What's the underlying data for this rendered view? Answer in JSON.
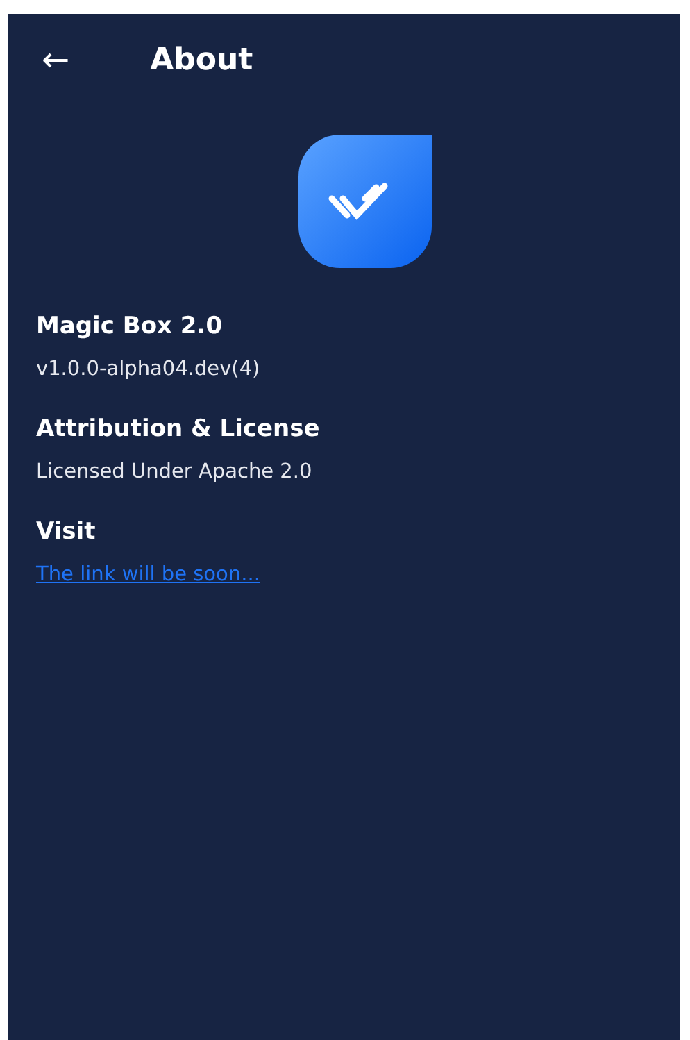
{
  "header": {
    "back": "←",
    "title": "About"
  },
  "sections": [
    {
      "title": "Magic Box 2.0",
      "kind": "text",
      "body": "v1.0.0-alpha04.dev(4)"
    },
    {
      "title": "Attribution & License",
      "kind": "text",
      "body": "Licensed Under Apache 2.0"
    },
    {
      "title": "Visit",
      "kind": "link",
      "body": "The link will be soon..."
    }
  ]
}
